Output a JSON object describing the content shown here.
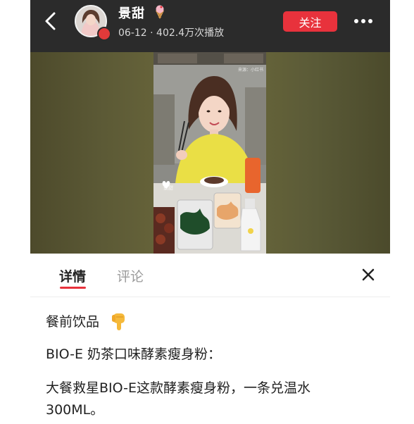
{
  "header": {
    "username": "景甜",
    "meta": "06-12 · 402.4万次播放",
    "follow_label": "关注",
    "icons": {
      "back": "back-chevron-icon",
      "verified": "verified-badge-icon",
      "emoji": "ice-cream-icon",
      "more": "more-dots-icon"
    }
  },
  "video": {
    "watermark_top": "来源：小红书",
    "watermark_mid": "景甜"
  },
  "tabs": [
    {
      "label": "详情",
      "active": true
    },
    {
      "label": "评论",
      "active": false
    }
  ],
  "details": {
    "line1": "餐前饮品",
    "line1_icon": "pointing-down-hand-icon",
    "line2": "BIO-E 奶茶口味酵素瘦身粉：",
    "line3": "大餐救星BIO-E这款酵素瘦身粉，一条兑温水",
    "line4": "300ML。"
  },
  "colors": {
    "header_bg": "#2b2b2b",
    "accent": "#e8323c",
    "text": "#222222",
    "muted": "#9a9a9a"
  }
}
